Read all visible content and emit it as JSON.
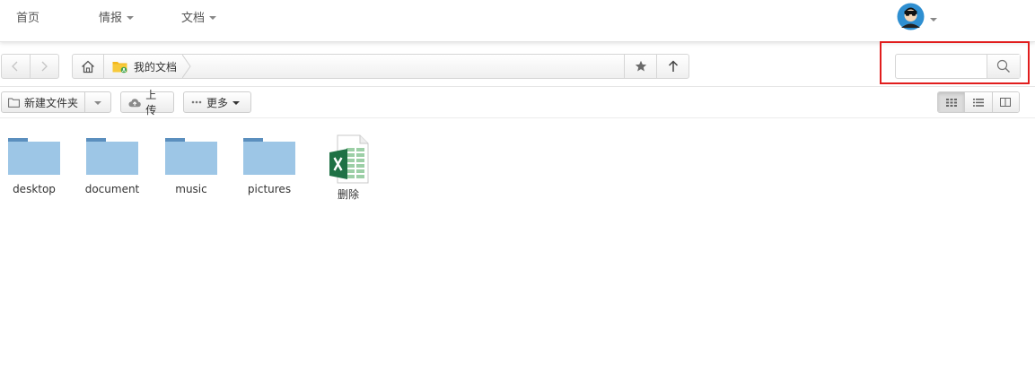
{
  "topnav": {
    "items": [
      {
        "label": "首页",
        "has_dropdown": false
      },
      {
        "label": "情报",
        "has_dropdown": true
      },
      {
        "label": "文档",
        "has_dropdown": true
      }
    ],
    "avatar_icon": "user-avatar-icon"
  },
  "pathbar": {
    "home_icon": "home-icon",
    "breadcrumb": [
      {
        "label": "我的文档",
        "icon": "shared-folder-icon"
      }
    ],
    "star_icon": "star-icon",
    "up_icon": "arrow-up-icon"
  },
  "search": {
    "value": "",
    "placeholder": "",
    "icon": "search-icon"
  },
  "toolbar": {
    "new_folder_label": "新建文件夹",
    "upload_label": "上传",
    "more_label": "更多"
  },
  "view_modes": [
    "grid-view",
    "list-view",
    "columns-view"
  ],
  "active_view": "grid-view",
  "files": [
    {
      "name": "desktop",
      "type": "folder"
    },
    {
      "name": "document",
      "type": "folder"
    },
    {
      "name": "music",
      "type": "folder"
    },
    {
      "name": "pictures",
      "type": "folder"
    },
    {
      "name": "删除",
      "type": "excel"
    }
  ],
  "colors": {
    "folder": "#9dc6e6",
    "folder_tab": "#5b8fbe",
    "highlight": "#e11d1d",
    "excel_green": "#1e7145"
  }
}
